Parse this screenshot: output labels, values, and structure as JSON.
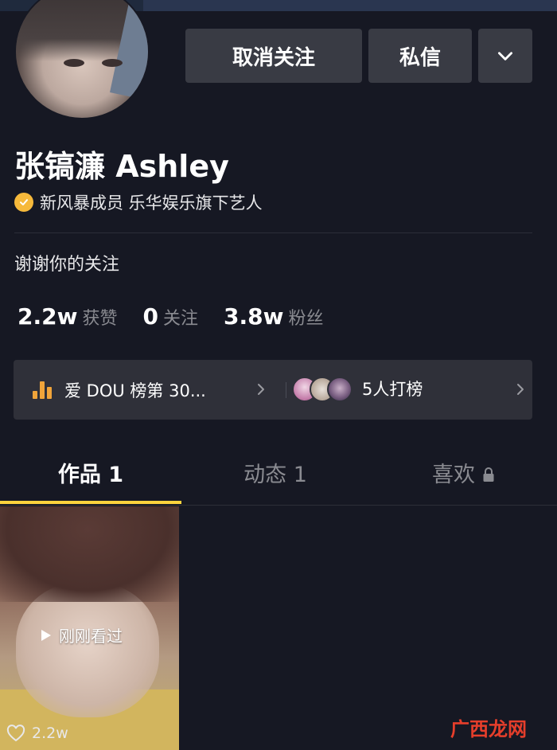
{
  "header": {
    "unfollow_label": "取消关注",
    "message_label": "私信",
    "more_icon": "chevron-down-icon"
  },
  "profile": {
    "name": "张镐濂 Ashley",
    "verified_icon": "verified-check-icon",
    "verified_text": "新风暴成员 乐华娱乐旗下艺人",
    "bio": "谢谢你的关注"
  },
  "stats": [
    {
      "value": "2.2w",
      "label": "获赞"
    },
    {
      "value": "0",
      "label": "关注"
    },
    {
      "value": "3.8w",
      "label": "粉丝"
    }
  ],
  "rank": {
    "icon": "bar-chart-icon",
    "text": "爱 DOU 榜第 30...",
    "fans_text": "5人打榜",
    "accent_color": "#f0a43a"
  },
  "tabs": [
    {
      "label": "作品 1",
      "active": true
    },
    {
      "label": "动态 1",
      "active": false
    },
    {
      "label": "喜欢",
      "active": false,
      "icon": "lock-icon"
    }
  ],
  "video": {
    "overlay_text": "刚刚看过",
    "likes": "2.2w"
  },
  "watermark": {
    "text": "广西龙网"
  },
  "colors": {
    "background": "#161823",
    "button": "#393b44",
    "tab_underline": "#fdd33d",
    "verified_badge": "#f6b93b"
  }
}
